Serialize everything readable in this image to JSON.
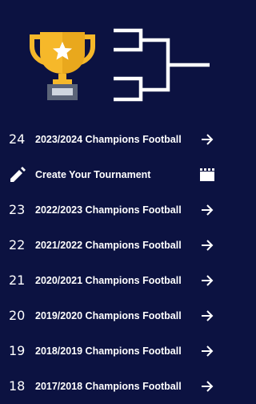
{
  "header": {
    "trophy_icon": "trophy-icon",
    "bracket_icon": "tournament-bracket-icon"
  },
  "colors": {
    "background": "#0c1241",
    "trophy_gold": "#f6b82a",
    "trophy_base": "#5b6478",
    "text": "#ffffff"
  },
  "items": [
    {
      "number": "24",
      "label": "2023/2024 Champions Football",
      "trailing_icon": "arrow-right-icon"
    },
    {
      "number": "",
      "label": "Create Your Tournament",
      "leading_icon": "pencil-icon",
      "trailing_icon": "clapperboard-icon"
    },
    {
      "number": "23",
      "label": "2022/2023 Champions Football",
      "trailing_icon": "arrow-right-icon"
    },
    {
      "number": "22",
      "label": "2021/2022 Champions Football",
      "trailing_icon": "arrow-right-icon"
    },
    {
      "number": "21",
      "label": "2020/2021 Champions Football",
      "trailing_icon": "arrow-right-icon"
    },
    {
      "number": "20",
      "label": "2019/2020 Champions Football",
      "trailing_icon": "arrow-right-icon"
    },
    {
      "number": "19",
      "label": "2018/2019 Champions Football",
      "trailing_icon": "arrow-right-icon"
    },
    {
      "number": "18",
      "label": "2017/2018 Champions Football",
      "trailing_icon": "arrow-right-icon"
    }
  ]
}
